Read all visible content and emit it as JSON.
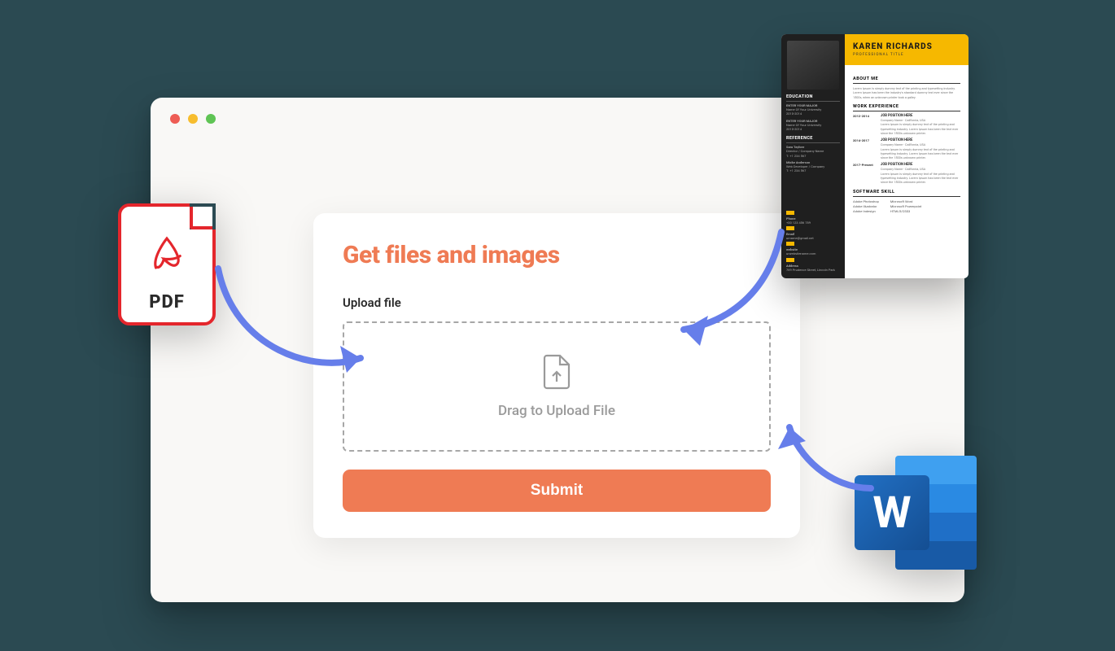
{
  "card": {
    "title": "Get files and images",
    "label": "Upload file",
    "dropzone_text": "Drag to Upload File",
    "submit_label": "Submit"
  },
  "pdf": {
    "label": "PDF"
  },
  "word": {
    "glyph": "W"
  },
  "resume": {
    "name": "KAREN RICHARDS",
    "subtitle": "PROFESSIONAL TITLE",
    "left": {
      "education_h": "EDUCATION",
      "edu1_major": "ENTER YOUR MAJOR",
      "edu1_uni": "Name Of Your University",
      "edu1_years": "2010-2014",
      "edu2_major": "ENTER YOUR MAJOR",
      "edu2_uni": "Name Of Your University",
      "edu2_years": "2010-2014",
      "reference_h": "REFERENCE",
      "ref1_name": "Sara Taylore",
      "ref1_role": "Director / Company Name",
      "ref1_tel": "T: +1 234 567",
      "ref2_name": "Micke Anderson",
      "ref2_role": "Web Developer / Company",
      "ref2_tel": "T: +1 234 567",
      "phone_label": "Phone",
      "phone_val": "+00 123 456 789",
      "email_label": "Email",
      "email_val": "urname@gmail.net",
      "website_label": "website",
      "website_val": "urwebsitename.com",
      "address_label": "Address",
      "address_val": "769 Prudence Street, Lincoln Park"
    },
    "right": {
      "about_h": "ABOUT ME",
      "about_body": "Lorem Ipsum is simply dummy text of the printing and typesetting industry. Lorem Ipsum has been the industry's standard dummy text ever since the 1500s, when an unknown printer took a galley.",
      "exp_h": "WORK EXPERIENCE",
      "exp": [
        {
          "yr": "2012-2014",
          "title": "JOB POSITION HERE",
          "sub": "Company Name - California, USA",
          "body": "Lorem Ipsum is simply dummy text of the printing and typesetting industry. Lorem Ipsum has been the text ever since the 1500s unknown printer."
        },
        {
          "yr": "2014-2017",
          "title": "JOB POSITION HERE",
          "sub": "Company Name - California, USA",
          "body": "Lorem Ipsum is simply dummy text of the printing and typesetting industry. Lorem Ipsum has been the text ever since the 1500s unknown printer."
        },
        {
          "yr": "2017-Present",
          "title": "JOB POSITION HERE",
          "sub": "Company Name - California, USA",
          "body": "Lorem Ipsum is simply dummy text of the printing and typesetting industry. Lorem Ipsum has been the text ever since the 1500s unknown printer."
        }
      ],
      "skill_h": "SOFTWARE SKILL",
      "skills_a": [
        "Adobe Photoshop",
        "Adobe Illustrator",
        "Adobe Indesign"
      ],
      "skills_b": [
        "Microsoft Word",
        "Microsoft Powerpoint",
        "HTML5/CSS3"
      ]
    }
  }
}
